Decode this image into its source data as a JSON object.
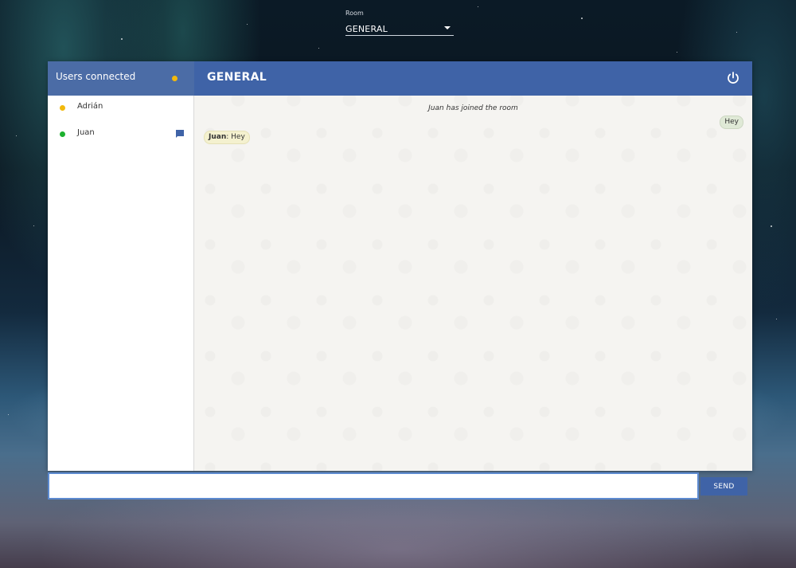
{
  "room_selector": {
    "label": "Room",
    "selected": "GENERAL"
  },
  "sidebar": {
    "title": "Users connected",
    "status_color": "#f2b90c",
    "users": [
      {
        "name": "Adrián",
        "status_color": "#f2b90c",
        "has_message_icon": false
      },
      {
        "name": "Juan",
        "status_color": "#1db12f",
        "has_message_icon": true
      }
    ]
  },
  "chat": {
    "title": "GENERAL",
    "messages": [
      {
        "type": "system",
        "text": "Juan has joined the room"
      },
      {
        "type": "own",
        "text": "Hey"
      },
      {
        "type": "other",
        "author": "Juan",
        "text": ": Hey"
      }
    ]
  },
  "composer": {
    "value": "",
    "placeholder": "",
    "send_label": "SEND"
  },
  "colors": {
    "header_blue": "#3f63a7",
    "sidebar_header_blue": "#4b6ca6",
    "online_green": "#1db12f",
    "away_yellow": "#f2b90c"
  }
}
